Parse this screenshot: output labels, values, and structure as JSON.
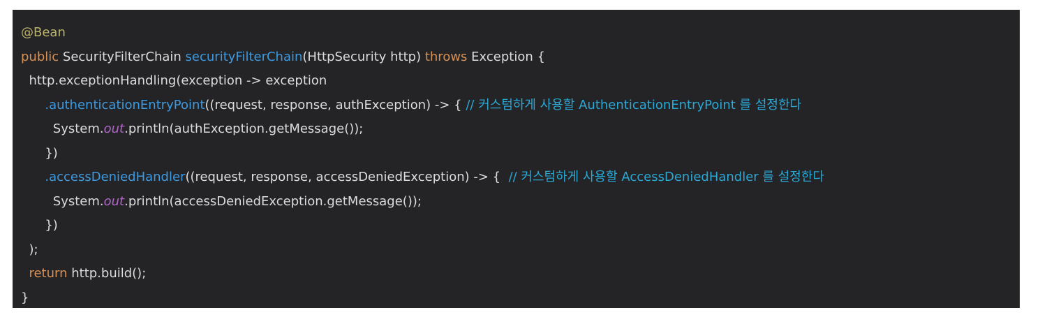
{
  "code": {
    "lines": [
      {
        "tokens": [
          {
            "t": "@Bean",
            "c": "ann"
          }
        ]
      },
      {
        "tokens": [
          {
            "t": "public",
            "c": "kw"
          },
          {
            "t": " SecurityFilterChain ",
            "c": "pl"
          },
          {
            "t": "securityFilterChain",
            "c": "fn"
          },
          {
            "t": "(HttpSecurity http) ",
            "c": "pl"
          },
          {
            "t": "throws",
            "c": "kw"
          },
          {
            "t": " Exception {",
            "c": "pl"
          }
        ]
      },
      {
        "tokens": [
          {
            "t": "  http.exceptionHandling(exception -> exception",
            "c": "pl"
          }
        ]
      },
      {
        "tokens": [
          {
            "t": "      ",
            "c": "pl"
          },
          {
            "t": ".authenticationEntryPoint",
            "c": "fn"
          },
          {
            "t": "((request, response, authException) -> { ",
            "c": "pl"
          },
          {
            "t": "// 커스텀하게 사용할 AuthenticationEntryPoint 를 설정한다",
            "c": "cm"
          }
        ]
      },
      {
        "tokens": [
          {
            "t": "        System.",
            "c": "pl"
          },
          {
            "t": "out",
            "c": "fld"
          },
          {
            "t": ".println(authException.getMessage());",
            "c": "pl"
          }
        ]
      },
      {
        "tokens": [
          {
            "t": "      })",
            "c": "pl"
          }
        ]
      },
      {
        "tokens": [
          {
            "t": "      ",
            "c": "pl"
          },
          {
            "t": ".accessDeniedHandler",
            "c": "fn"
          },
          {
            "t": "((request, response, accessDeniedException) -> {  ",
            "c": "pl"
          },
          {
            "t": "// 커스텀하게 사용할 AccessDeniedHandler 를 설정한다",
            "c": "cm"
          }
        ]
      },
      {
        "tokens": [
          {
            "t": "        System.",
            "c": "pl"
          },
          {
            "t": "out",
            "c": "fld"
          },
          {
            "t": ".println(accessDeniedException.getMessage());",
            "c": "pl"
          }
        ]
      },
      {
        "tokens": [
          {
            "t": "      })",
            "c": "pl"
          }
        ]
      },
      {
        "tokens": [
          {
            "t": "  );",
            "c": "pl"
          }
        ]
      },
      {
        "tokens": [
          {
            "t": "  ",
            "c": "pl"
          },
          {
            "t": "return",
            "c": "kw"
          },
          {
            "t": " http.build();",
            "c": "pl"
          }
        ]
      },
      {
        "tokens": [
          {
            "t": "}",
            "c": "pl"
          }
        ]
      }
    ]
  },
  "colors": {
    "background": "#242427",
    "annotation": "#b9b36a",
    "keyword": "#d79155",
    "method": "#3d9ae0",
    "comment": "#2aa7d4",
    "static_field": "#b168c8",
    "plain": "#dcdcdc"
  }
}
